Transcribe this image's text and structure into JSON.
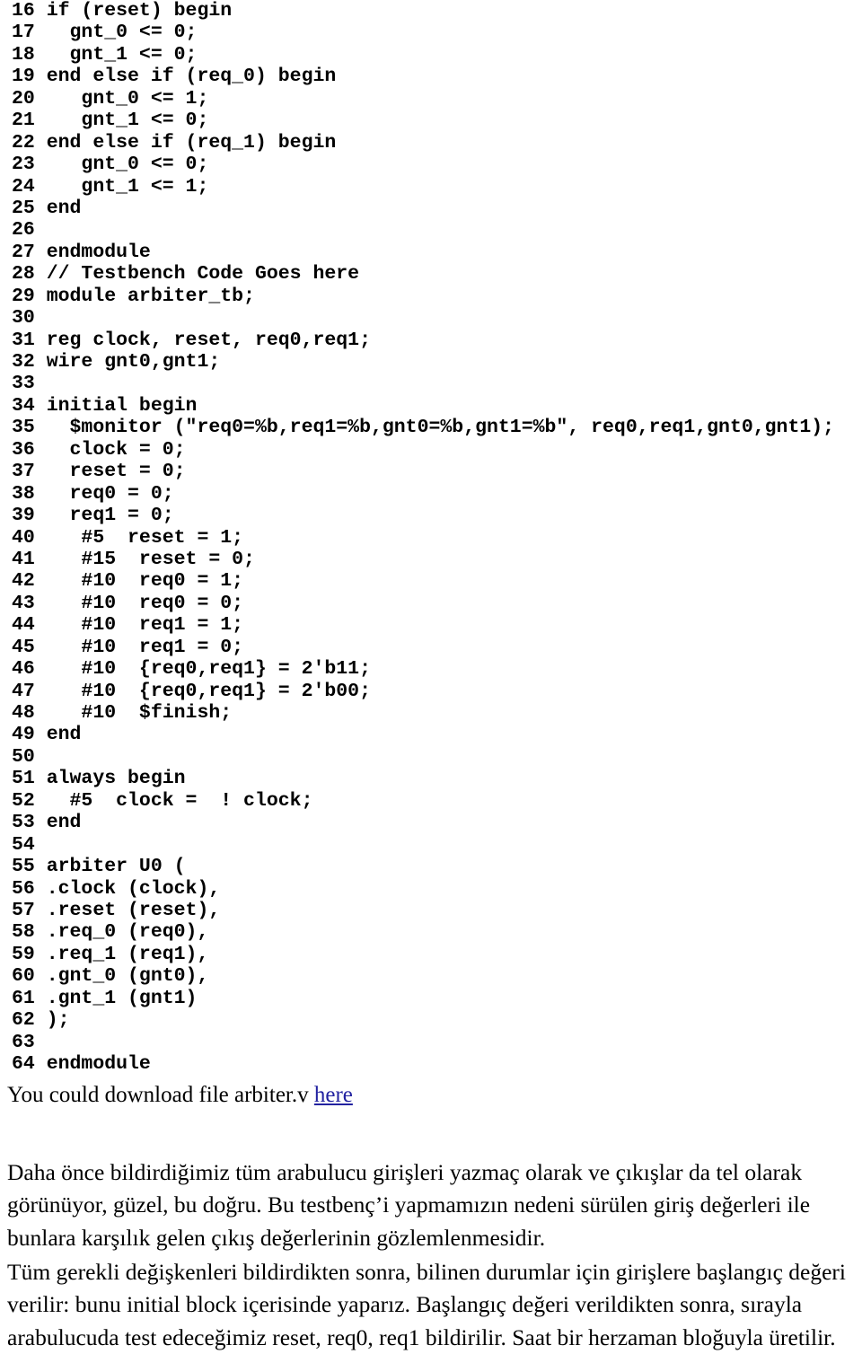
{
  "document": {
    "type": "verilog-tutorial-page",
    "language_of_prose": "Turkish",
    "link_color": "#2222a0",
    "text_color": "#000000",
    "background_color": "#ffffff"
  },
  "code_listing": {
    "language": "verilog",
    "first_line_number": 16,
    "last_line_number": 64,
    "lines": [
      {
        "number": "16",
        "text": "if (reset) begin"
      },
      {
        "number": "17",
        "text": "  gnt_0 <= 0;"
      },
      {
        "number": "18",
        "text": "  gnt_1 <= 0;"
      },
      {
        "number": "19",
        "text": "end else if (req_0) begin"
      },
      {
        "number": "20",
        "text": "   gnt_0 <= 1;"
      },
      {
        "number": "21",
        "text": "   gnt_1 <= 0;"
      },
      {
        "number": "22",
        "text": "end else if (req_1) begin"
      },
      {
        "number": "23",
        "text": "   gnt_0 <= 0;"
      },
      {
        "number": "24",
        "text": "   gnt_1 <= 1;"
      },
      {
        "number": "25",
        "text": "end"
      },
      {
        "number": "26",
        "text": ""
      },
      {
        "number": "27",
        "text": "endmodule"
      },
      {
        "number": "28",
        "text": "// Testbench Code Goes here"
      },
      {
        "number": "29",
        "text": "module arbiter_tb;"
      },
      {
        "number": "30",
        "text": ""
      },
      {
        "number": "31",
        "text": "reg clock, reset, req0,req1;"
      },
      {
        "number": "32",
        "text": "wire gnt0,gnt1;"
      },
      {
        "number": "33",
        "text": ""
      },
      {
        "number": "34",
        "text": "initial begin"
      },
      {
        "number": "35",
        "text": "  $monitor (\"req0=%b,req1=%b,gnt0=%b,gnt1=%b\", req0,req1,gnt0,gnt1);"
      },
      {
        "number": "36",
        "text": "  clock = 0;"
      },
      {
        "number": "37",
        "text": "  reset = 0;"
      },
      {
        "number": "38",
        "text": "  req0 = 0;"
      },
      {
        "number": "39",
        "text": "  req1 = 0;"
      },
      {
        "number": "40",
        "text": "   #5  reset = 1;"
      },
      {
        "number": "41",
        "text": "   #15  reset = 0;"
      },
      {
        "number": "42",
        "text": "   #10  req0 = 1;"
      },
      {
        "number": "43",
        "text": "   #10  req0 = 0;"
      },
      {
        "number": "44",
        "text": "   #10  req1 = 1;"
      },
      {
        "number": "45",
        "text": "   #10  req1 = 0;"
      },
      {
        "number": "46",
        "text": "   #10  {req0,req1} = 2'b11;"
      },
      {
        "number": "47",
        "text": "   #10  {req0,req1} = 2'b00;"
      },
      {
        "number": "48",
        "text": "   #10  $finish;"
      },
      {
        "number": "49",
        "text": "end"
      },
      {
        "number": "50",
        "text": ""
      },
      {
        "number": "51",
        "text": "always begin"
      },
      {
        "number": "52",
        "text": "  #5  clock =  ! clock;"
      },
      {
        "number": "53",
        "text": "end"
      },
      {
        "number": "54",
        "text": ""
      },
      {
        "number": "55",
        "text": "arbiter U0 ("
      },
      {
        "number": "56",
        "text": ".clock (clock),"
      },
      {
        "number": "57",
        "text": ".reset (reset),"
      },
      {
        "number": "58",
        "text": ".req_0 (req0),"
      },
      {
        "number": "59",
        "text": ".req_1 (req1),"
      },
      {
        "number": "60",
        "text": ".gnt_0 (gnt0),"
      },
      {
        "number": "61",
        "text": ".gnt_1 (gnt1)"
      },
      {
        "number": "62",
        "text": ");"
      },
      {
        "number": "63",
        "text": ""
      },
      {
        "number": "64",
        "text": "endmodule"
      }
    ]
  },
  "download": {
    "prefix": "You could download file arbiter.v ",
    "link_label": "here",
    "file_name": "arbiter.v"
  },
  "prose": {
    "paragraph_1": "Daha önce bildirdiğimiz tüm arabulucu girişleri yazmaç olarak ve çıkışlar da tel olarak görünüyor, güzel, bu doğru. Bu testbenç’i yapmamızın nedeni sürülen giriş değerleri ile bunlara karşılık gelen çıkış değerlerinin gözlemlenmesidir.",
    "paragraph_2": "Tüm gerekli değişkenleri bildirdikten sonra, bilinen durumlar için girişlere başlangıç değeri verilir: bunu initial block içerisinde yaparız. Başlangıç değeri verildikten sonra, sırayla arabulucuda test edeceğimiz reset, req0, req1 bildirilir. Saat bir herzaman bloğuyla üretilir."
  }
}
